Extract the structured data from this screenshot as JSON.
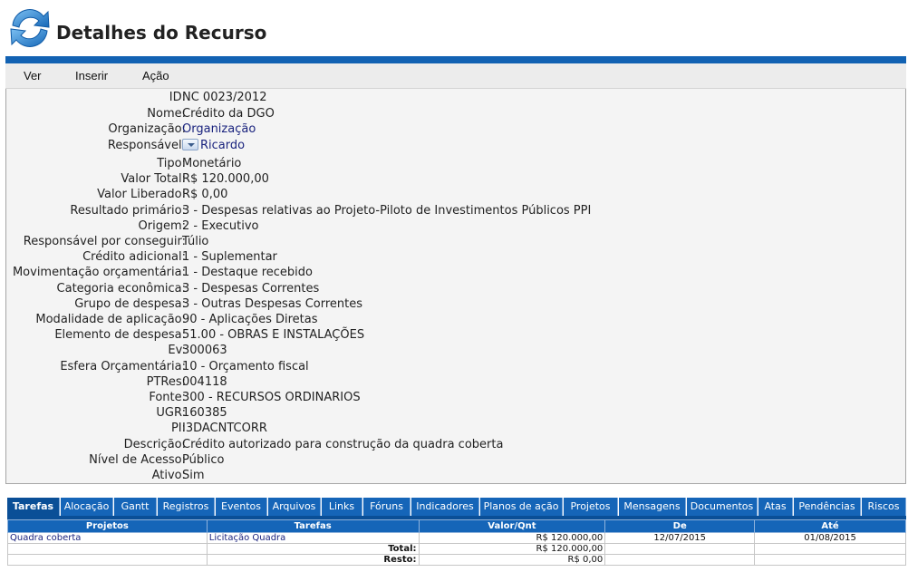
{
  "header": {
    "title": "Detalhes do Recurso",
    "logo_icon": "refresh-arrows-icon"
  },
  "menu": [
    "Ver",
    "Inserir",
    "Ação"
  ],
  "details": [
    {
      "label": "ID:",
      "value": "NC 0023/2012"
    },
    {
      "label": "Nome:",
      "value": "Crédito da DGO"
    },
    {
      "label": "Organização:",
      "value": "Organização",
      "link": true
    },
    {
      "label": "Responsável:",
      "value": "Ricardo",
      "link": true,
      "icon": "dropdown-icon"
    },
    {
      "label": "Tipo:",
      "value": "Monetário"
    },
    {
      "label": "Valor Total:",
      "value": "R$ 120.000,00"
    },
    {
      "label": "Valor Liberado:",
      "value": "R$ 0,00"
    },
    {
      "label": "Resultado primário:",
      "value": "3 - Despesas relativas ao Projeto-Piloto de Investimentos Públicos PPI"
    },
    {
      "label": "Origem:",
      "value": "2 - Executivo"
    },
    {
      "label": "Responsável por conseguir:",
      "value": "Túlio"
    },
    {
      "label": "Crédito adicional:",
      "value": "1 - Suplementar"
    },
    {
      "label": "Movimentação orçamentária:",
      "value": "1 - Destaque recebido"
    },
    {
      "label": "Categoria econômica:",
      "value": "3 - Despesas Correntes"
    },
    {
      "label": "Grupo de despesa:",
      "value": "3 - Outras Despesas Correntes"
    },
    {
      "label": "Modalidade de aplicação:",
      "value": "90 - Aplicações Diretas"
    },
    {
      "label": "Elemento de despesa:",
      "value": "51.00 - OBRAS E INSTALAÇÕES"
    },
    {
      "label": "Ev:",
      "value": "300063"
    },
    {
      "label": "Esfera Orçamentária:",
      "value": "10 - Orçamento fiscal"
    },
    {
      "label": "PTRes:",
      "value": "004118"
    },
    {
      "label": "Fonte:",
      "value": "300 - RECURSOS ORDINARIOS"
    },
    {
      "label": "UGR:",
      "value": "160385"
    },
    {
      "label": "PI:",
      "value": "I3DACNTCORR"
    },
    {
      "label": "Descrição:",
      "value": "Crédito autorizado para construção da quadra coberta"
    },
    {
      "label": "Nível de Acesso:",
      "value": "Público"
    },
    {
      "label": "Ativo:",
      "value": "Sim"
    }
  ],
  "tabs": [
    {
      "label": "Tarefas",
      "active": true
    },
    {
      "label": "Alocação"
    },
    {
      "label": "Gantt"
    },
    {
      "label": "Registros"
    },
    {
      "label": "Eventos"
    },
    {
      "label": "Arquivos"
    },
    {
      "label": "Links"
    },
    {
      "label": "Fóruns"
    },
    {
      "label": "Indicadores"
    },
    {
      "label": "Planos de ação"
    },
    {
      "label": "Projetos"
    },
    {
      "label": "Mensagens"
    },
    {
      "label": "Documentos"
    },
    {
      "label": "Atas"
    },
    {
      "label": "Pendências"
    },
    {
      "label": "Riscos"
    }
  ],
  "table": {
    "columns": [
      "Projetos",
      "Tarefas",
      "Valor/Qnt",
      "De",
      "Até"
    ],
    "rows": [
      {
        "projeto": "Quadra coberta",
        "tarefa": "Licitação Quadra",
        "valor": "R$ 120.000,00",
        "de": "12/07/2015",
        "ate": "01/08/2015"
      }
    ],
    "total_label": "Total:",
    "total_value": "R$ 120.000,00",
    "resto_label": "Resto:",
    "resto_value": "R$ 0,00"
  },
  "colors": {
    "accent": "#1565b8",
    "tab_active": "#0a4f97",
    "link": "#1a237e"
  }
}
